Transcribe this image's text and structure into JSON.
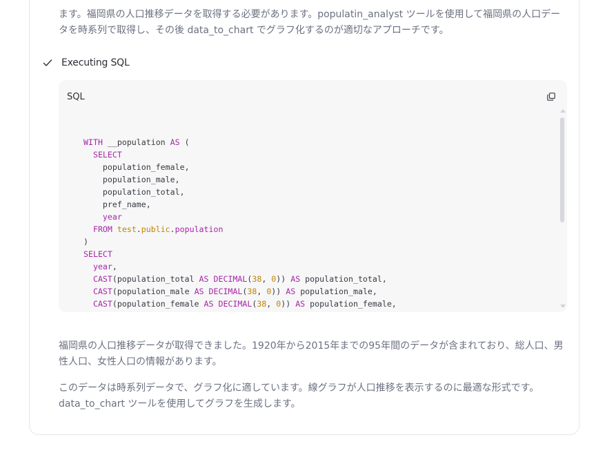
{
  "intro_text": "ます。福岡県の人口推移データを取得する必要があります。populatin_analyst ツールを使用して福岡県の人口データを時系列で取得し、その後 data_to_chart でグラフ化するのが適切なアプローチです。",
  "step": {
    "label": "Executing SQL",
    "status": "complete"
  },
  "code_block": {
    "language_label": "SQL",
    "copy_tooltip": "",
    "lines": [
      "WITH __population AS (",
      "  SELECT",
      "    population_female,",
      "    population_male,",
      "    population_total,",
      "    pref_name,",
      "    year",
      "  FROM test.public.population",
      ")",
      "SELECT",
      "  year,",
      "  CAST(population_total AS DECIMAL(38, 0)) AS population_total,",
      "  CAST(population_male AS DECIMAL(38, 0)) AS population_male,",
      "  CAST(population_female AS DECIMAL(38, 0)) AS population_female,"
    ]
  },
  "paragraphs": [
    "福岡県の人口推移データが取得できました。1920年から2015年までの95年間のデータが含まれており、総人口、男性人口、女性人口の情報があります。",
    "このデータは時系列データで、グラフ化に適しています。線グラフが人口推移を表示するのに最適な形式です。data_to_chart ツールを使用してグラフを生成します。"
  ],
  "colors": {
    "keyword": "#a626a4",
    "function": "#4078f2",
    "number": "#c18401",
    "text": "#383a42",
    "accent_check": "#2b2e36"
  },
  "icons": {
    "step_icon": "check-icon",
    "copy_icon": "copy-icon"
  }
}
